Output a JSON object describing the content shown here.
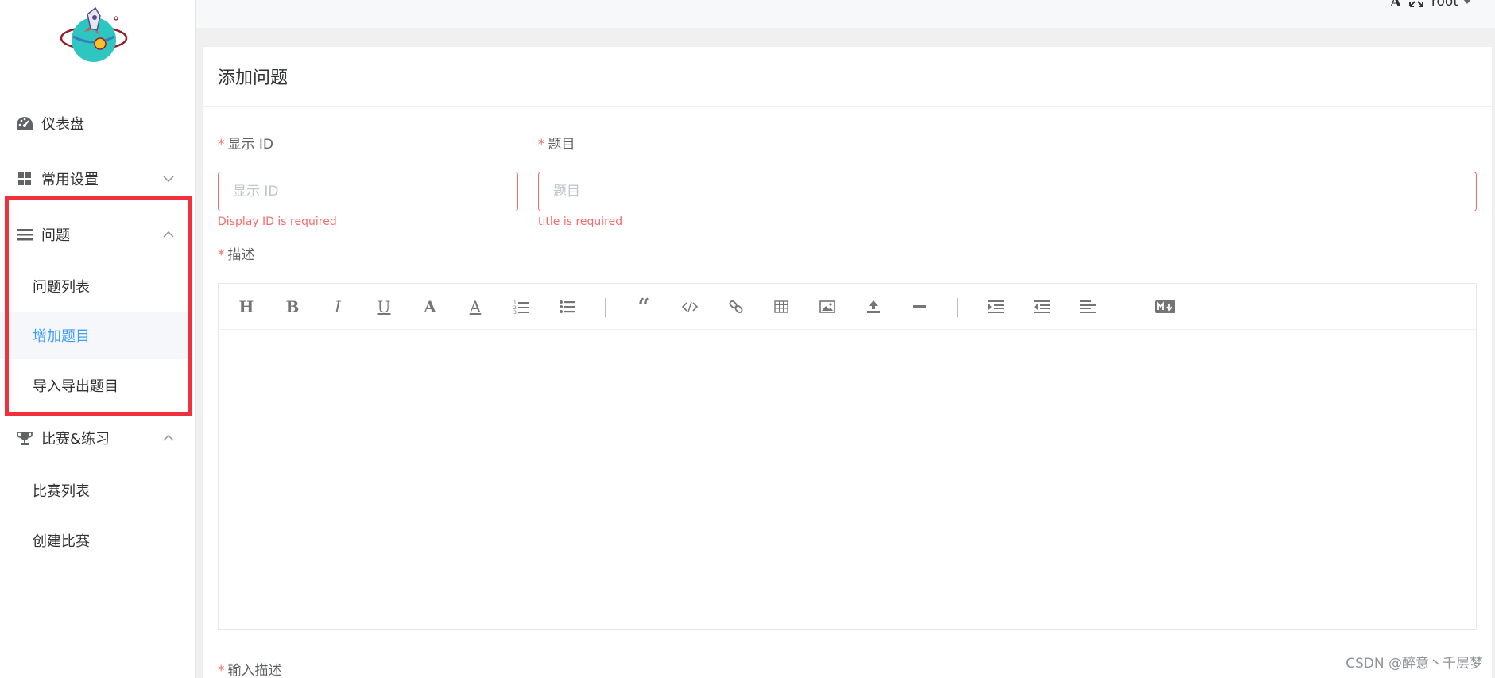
{
  "sidebar": {
    "logo": "rocket-planet-logo",
    "items": [
      {
        "label": "仪表盘",
        "icon": "dashboard-icon"
      },
      {
        "label": "常用设置",
        "icon": "grid-icon"
      },
      {
        "label": "问题",
        "icon": "list-icon"
      },
      {
        "label": "比赛&练习",
        "icon": "trophy-icon"
      }
    ],
    "problem_sub": [
      "问题列表",
      "增加题目",
      "导入导出题目"
    ],
    "contest_sub": [
      "比赛列表",
      "创建比赛"
    ]
  },
  "topbar": {
    "font_icon": "A",
    "user": "root"
  },
  "card": {
    "title": "添加问题",
    "required_mark": "*",
    "display_id": {
      "label": "显示 ID",
      "placeholder": "显示 ID",
      "error": "Display ID is required"
    },
    "title_field": {
      "label": "题目",
      "placeholder": "题目",
      "error": "title is required"
    },
    "description": {
      "label": "描述"
    },
    "input_description": {
      "label": "输入描述"
    }
  },
  "toolbar_icons": [
    "header-icon",
    "bold-icon",
    "italic-icon",
    "underline-icon",
    "strikethrough-icon",
    "mark-icon",
    "ordered-list-icon",
    "unordered-list-icon",
    "quote-icon",
    "code-icon",
    "link-icon",
    "table-icon",
    "image-icon",
    "upload-icon",
    "horizontal-rule-icon",
    "indent-icon",
    "outdent-icon",
    "align-left-icon",
    "markdown-icon"
  ],
  "watermark": "CSDN @醉意丶千层梦",
  "colors": {
    "accent": "#409eff",
    "error": "#f56c6c",
    "highlight": "#f0313b"
  }
}
